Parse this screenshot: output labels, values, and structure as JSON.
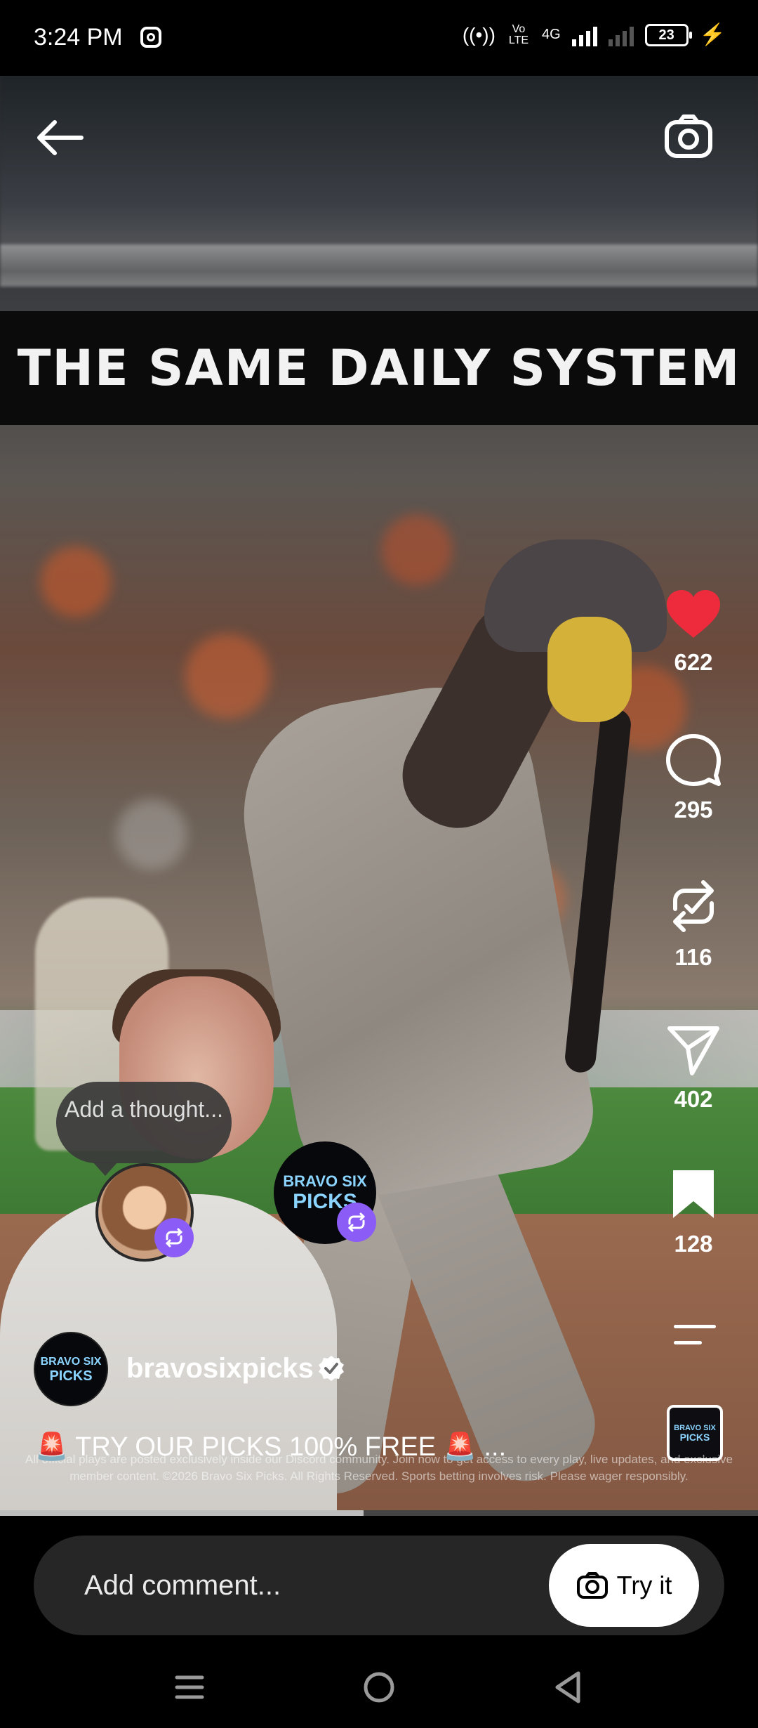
{
  "status_bar": {
    "time": "3:24 PM",
    "network_labels": [
      "Vo LTE",
      "4G"
    ],
    "battery": "23"
  },
  "video": {
    "overlay_text": "THE SAME DAILY SYSTEM",
    "progress_fraction": 0.48
  },
  "actions": {
    "likes": "622",
    "comments": "295",
    "reposts": "116",
    "shares": "402",
    "saves": "128",
    "like_color": "#ed2b3c"
  },
  "thought_bubble": {
    "text": "Add a thought..."
  },
  "brand_logo": {
    "line1": "BRAVO SIX",
    "line2": "PICKS"
  },
  "post": {
    "username": "bravosixpicks",
    "caption": "🚨 TRY OUR PICKS 100% FREE 🚨 ...",
    "fineprint": "All official plays are posted exclusively inside our Discord community. Join now to get access to every play, live updates, and exclusive member content. ©2026 Bravo Six Picks. All Rights Reserved. Sports betting involves risk. Please wager responsibly."
  },
  "comment_bar": {
    "placeholder": "Add comment...",
    "try_it_label": "Try it"
  },
  "icons": {
    "back": "back-arrow-icon",
    "camera": "camera-icon",
    "like": "heart-icon",
    "comment": "comment-icon",
    "repost": "repost-icon",
    "share": "send-icon",
    "save": "bookmark-icon"
  }
}
